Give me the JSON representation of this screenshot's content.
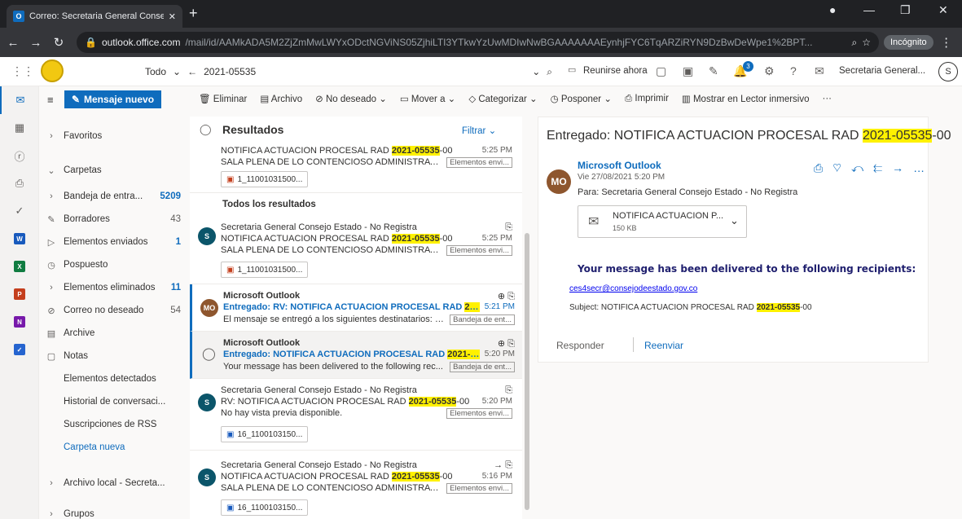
{
  "browser": {
    "tab_title": "Correo: Secretaria General Conse",
    "url_host": "outlook.office.com",
    "url_path": "/mail/id/AAMkADA5M2ZjZmMwLWYxODctNGViNS05ZjhiLTI3YTkwYzUwMDIwNwBGAAAAAAAEynhjFYC6TqARZiRYN9DzBwDeWpe1%2BPT...",
    "incognito": "Incógnito"
  },
  "header": {
    "scope": "Todo",
    "search_value": "2021-05535",
    "meet": "Reunirse ahora",
    "badge": "3",
    "user": "Secretaria General...",
    "avatar": "S"
  },
  "compose": "Mensaje nuevo",
  "folders": {
    "favorites": "Favoritos",
    "folders": "Carpetas",
    "inbox": "Bandeja de entra...",
    "inbox_count": "5209",
    "drafts": "Borradores",
    "drafts_count": "43",
    "sent": "Elementos enviados",
    "sent_count": "1",
    "postponed": "Pospuesto",
    "deleted": "Elementos eliminados",
    "deleted_count": "11",
    "junk": "Correo no deseado",
    "junk_count": "54",
    "archive": "Archive",
    "notes": "Notas",
    "detected": "Elementos detectados",
    "history": "Historial de conversaci...",
    "rss": "Suscripciones de RSS",
    "new_folder": "Carpeta nueva",
    "local": "Archivo local - Secreta...",
    "groups": "Grupos"
  },
  "toolbar": {
    "delete": "Eliminar",
    "archive": "Archivo",
    "junk": "No deseado",
    "move": "Mover a",
    "categorize": "Categorizar",
    "postpone": "Posponer",
    "print": "Imprimir",
    "immersive": "Mostrar en Lector inmersivo",
    "more": "···"
  },
  "list": {
    "title": "Resultados",
    "filter": "Filtrar",
    "all_results": "Todos los resultados",
    "top": {
      "subject_pre": "NOTIFICA ACTUACION PROCESAL RAD ",
      "hl": "2021-05535",
      "subject_post": "-00",
      "time": "5:25 PM",
      "preview": "SALA PLENA DE LO CONTENCIOSO ADMINISTRATIVO...",
      "chip": "Elementos envi...",
      "attach": "1_11001031500..."
    },
    "items": [
      {
        "av": "S",
        "sender": "Secretaria General Consejo Estado - No Registra",
        "subject_pre": "NOTIFICA ACTUACION PROCESAL RAD ",
        "hl": "2021-05535",
        "subject_post": "-00",
        "time": "5:25 PM",
        "preview": "SALA PLENA DE LO CONTENCIOSO ADMINISTRATIVO...",
        "chip": "Elementos envi...",
        "attach": "1_11001031500..."
      },
      {
        "av": "MO",
        "sender": "Microsoft Outlook",
        "subject_pre": "Entregado: RV: NOTIFICA ACTUACION PROCESAL RAD ",
        "hl": "2021-...",
        "subject_post": "",
        "time": "5:21 PM",
        "preview": "El mensaje se entregó a los siguientes destinatarios: S...",
        "chip": "Bandeja de ent..."
      },
      {
        "av": "",
        "sender": "Microsoft Outlook",
        "subject_pre": "Entregado: NOTIFICA ACTUACION PROCESAL RAD ",
        "hl": "2021-055...",
        "subject_post": "",
        "time": "5:20 PM",
        "preview": "Your message has been delivered to the following rec...",
        "chip": "Bandeja de ent..."
      },
      {
        "av": "S",
        "sender": "Secretaria General Consejo Estado - No Registra",
        "subject_pre": "RV: NOTIFICA ACTUACION PROCESAL RAD ",
        "hl": "2021-05535",
        "subject_post": "-00",
        "time": "5:20 PM",
        "preview": "No hay vista previa disponible.",
        "chip": "Elementos envi...",
        "attach": "16_1100103150..."
      },
      {
        "av": "S",
        "sender": "Secretaria General Consejo Estado - No Registra",
        "subject_pre": "NOTIFICA ACTUACION PROCESAL RAD ",
        "hl": "2021-05535",
        "subject_post": "-00",
        "time": "5:16 PM",
        "preview": "SALA PLENA DE LO CONTENCIOSO ADMINISTRATIVO...",
        "chip": "Elementos envi...",
        "attach": "16_1100103150..."
      }
    ]
  },
  "reading": {
    "title_pre": "Entregado: NOTIFICA ACTUACION PROCESAL RAD ",
    "title_hl": "2021-05535",
    "title_post": "-00",
    "av": "MO",
    "from": "Microsoft Outlook",
    "date": "Vie 27/08/2021 5:20 PM",
    "to": "Para:  Secretaria General Consejo Estado - No Registra",
    "att_name": "NOTIFICA ACTUACION P...",
    "att_size": "150 KB",
    "body_head": "Your message has been delivered to the following recipients:",
    "email": "ces4secr@consejodeestado.gov.co",
    "subj_pre": "Subject: NOTIFICA ACTUACION PROCESAL RAD ",
    "subj_hl": "2021-05535",
    "subj_post": "-00",
    "reply": "Responder",
    "forward": "Reenviar"
  }
}
